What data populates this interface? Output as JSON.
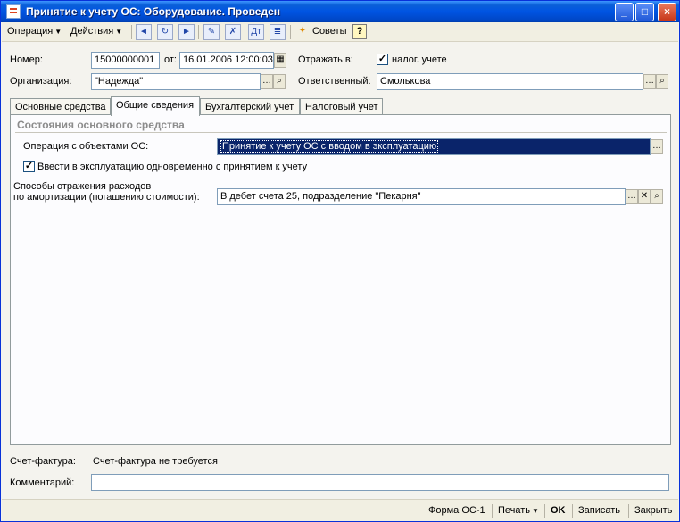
{
  "window": {
    "title": "Принятие к учету ОС: Оборудование. Проведен"
  },
  "menu": {
    "operation": "Операция",
    "actions": "Действия",
    "tips": "Советы",
    "help": "?"
  },
  "header": {
    "number_label": "Номер:",
    "number_value": "15000000001",
    "date_label": "от:",
    "date_value": "16.01.2006 12:00:03",
    "reflect_label": "Отражать в:",
    "tax_check_label": "налог. учете",
    "tax_checked": true,
    "org_label": "Организация:",
    "org_value": "\"Надежда\"",
    "resp_label": "Ответственный:",
    "resp_value": "Смолькова"
  },
  "tabs": [
    "Основные средства",
    "Общие сведения",
    "Бухгалтерский учет",
    "Налоговый учет"
  ],
  "active_tab": 1,
  "panel": {
    "group_title": "Состояния основного средства",
    "operation_label": "Операция с объектами ОС:",
    "operation_value": "Принятие к учету ОС с вводом в эксплуатацию",
    "commission_label": "Ввести в эксплуатацию одновременно с принятием к учету",
    "commission_checked": true,
    "expense_label_1": "Способы отражения расходов",
    "expense_label_2": "по амортизации (погашению стоимости):",
    "expense_value": "В дебет счета 25, подразделение \"Пекарня\""
  },
  "footer": {
    "invoice_label": "Счет-фактура:",
    "invoice_value": "Счет-фактура не требуется",
    "comment_label": "Комментарий:",
    "comment_value": ""
  },
  "status": {
    "form": "Форма ОС-1",
    "print": "Печать",
    "ok": "OK",
    "save": "Записать",
    "close": "Закрыть"
  },
  "colors": {
    "title_bar": "#0054e3",
    "selection": "#0a246a",
    "window_bg": "#f4f3ee"
  }
}
